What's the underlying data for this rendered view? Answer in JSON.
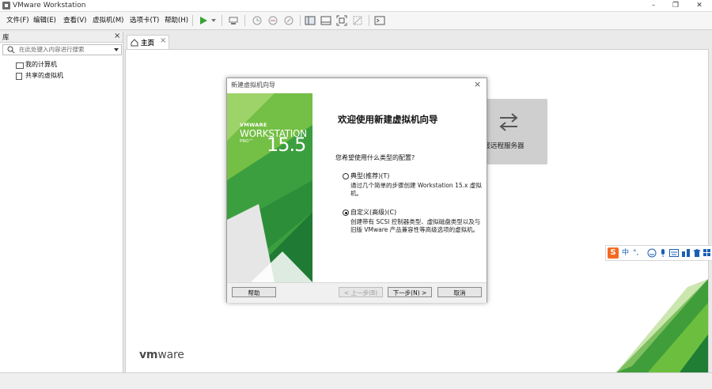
{
  "window": {
    "title": "VMware Workstation",
    "minimize": "–",
    "restore": "❐",
    "close": "✕"
  },
  "menu": [
    "文件(F)",
    "编辑(E)",
    "查看(V)",
    "虚拟机(M)",
    "选项卡(T)",
    "帮助(H)"
  ],
  "library": {
    "title": "库",
    "close": "×",
    "search_placeholder": "在此处键入内容进行搜索",
    "items": [
      "我的计算机",
      "共享的虚拟机"
    ]
  },
  "tabs": [
    {
      "label": "主页",
      "close": "×"
    }
  ],
  "home": {
    "remote_label": "连接远程服务器",
    "logo_text": "vm",
    "logo_text2": "ware"
  },
  "dialog": {
    "title": "新建虚拟机向导",
    "close": "×",
    "banner": {
      "brand": "VMWARE",
      "product": "WORKSTATION",
      "edition": "PRO™",
      "version": "15.5"
    },
    "heading": "欢迎使用新建虚拟机向导",
    "question": "您希望使用什么类型的配置?",
    "options": [
      {
        "label": "典型(推荐)(T)",
        "desc": "通过几个简单的步骤创建 Workstation 15.x 虚拟机。",
        "selected": false
      },
      {
        "label": "自定义(高级)(C)",
        "desc": "创建带有 SCSI 控制器类型、虚拟磁盘类型以及与旧版 VMware 产品兼容性等高级选项的虚拟机。",
        "selected": true
      }
    ],
    "buttons": {
      "help": "帮助",
      "back": "< 上一步(B)",
      "next": "下一步(N) >",
      "cancel": "取消"
    }
  },
  "ime": {
    "logo": "S",
    "mode": "中",
    "punct": "°,"
  }
}
